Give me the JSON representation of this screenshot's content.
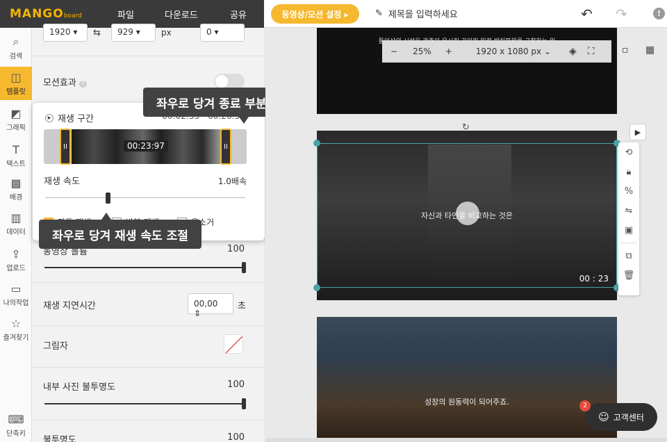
{
  "header": {
    "logo": "MANGO",
    "logo_sub": "board",
    "menu": [
      "파일",
      "다운로드",
      "공유"
    ],
    "motion_button": "동영상/모션 설정 ▸",
    "title_placeholder": "제목을 입력하세요"
  },
  "rail": [
    {
      "label": "검색",
      "icon": "search-icon",
      "glyph": "🔍"
    },
    {
      "label": "템플릿",
      "icon": "template-icon",
      "glyph": "▦"
    },
    {
      "label": "그래픽",
      "icon": "graphic-icon",
      "glyph": "◩"
    },
    {
      "label": "텍스트",
      "icon": "text-icon",
      "glyph": "T"
    },
    {
      "label": "배경",
      "icon": "background-icon",
      "glyph": "▩"
    },
    {
      "label": "데이터",
      "icon": "chart-icon",
      "glyph": "▥"
    },
    {
      "label": "업로드",
      "icon": "upload-icon",
      "glyph": "⇪"
    },
    {
      "label": "나의작업",
      "icon": "folder-icon",
      "glyph": "▭"
    },
    {
      "label": "즐겨찾기",
      "icon": "star-icon",
      "glyph": "☆"
    },
    {
      "label": "단축키",
      "icon": "keyboard-icon",
      "glyph": "⌨"
    }
  ],
  "panel": {
    "width_value": "1920",
    "height_value": "929",
    "unit": "px",
    "rotate_value": "0",
    "motion_label": "모션효과",
    "volume_label": "동영상 볼륨",
    "volume_value": "100",
    "delay_label": "재생 지연시간",
    "delay_value": "00,00",
    "delay_unit": "초",
    "shadow_label": "그림자",
    "inner_opacity_label": "내부 사진 불투명도",
    "inner_opacity_value": "100",
    "opacity_label": "불투명도",
    "opacity_value": "100"
  },
  "popup": {
    "section_label": "재생 구간",
    "range_text": "00:02:55 - 00:26:52",
    "clip_time": "00:23:97",
    "speed_label": "재생 속도",
    "speed_value": "1.0배속",
    "autoplay_label": "자동 재생",
    "loop_label": "반복 재생",
    "mute_label": "음소거"
  },
  "tooltips": {
    "trim": "좌우로 당겨 종료 부분 조절",
    "speed": "좌우로 당겨 재생 속도 조절"
  },
  "canvas": {
    "zoom_minus": "−",
    "zoom_value": "25%",
    "zoom_plus": "+",
    "size_value": "1920 x 1080 px",
    "slide1_caption": "둘이상의 시설을 관주이 유시킴 가이킴 일련 방치파워를 고찰하는 일",
    "slide2_caption": "자신과 타인을 비교하는 것은",
    "slide2_time": "00 : 23",
    "slide3_caption": "성장의 원동력이 되어주죠."
  },
  "support": {
    "badge": "2",
    "label": "고객센터"
  },
  "colors": {
    "accent": "#f5b82e",
    "dark": "#3a3a3a",
    "selection": "#4aa3a8"
  }
}
